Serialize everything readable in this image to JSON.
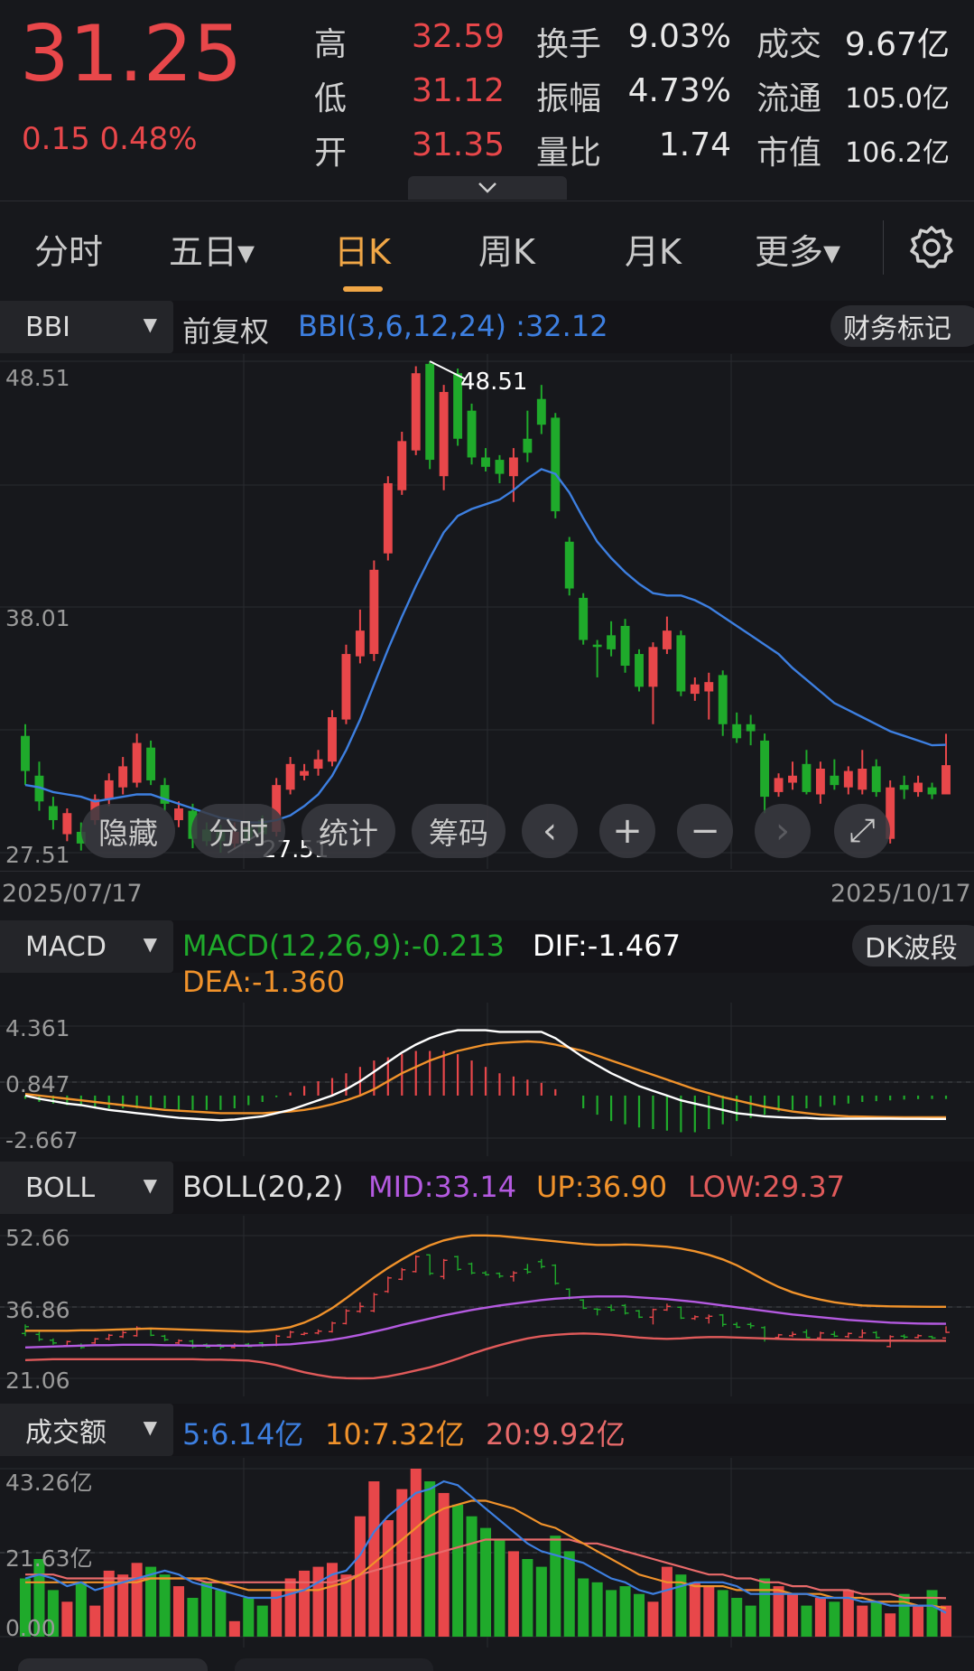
{
  "quote": {
    "price": "31.25",
    "change": "0.15",
    "change_pct": "0.48%",
    "high_label": "高",
    "high": "32.59",
    "low_label": "低",
    "low": "31.12",
    "open_label": "开",
    "open": "31.35",
    "turnover_label": "换手",
    "turnover": "9.03%",
    "amplitude_label": "振幅",
    "amplitude": "4.73%",
    "volratio_label": "量比",
    "volratio": "1.74",
    "amount_label": "成交",
    "amount": "9.67亿",
    "float_label": "流通",
    "float": "105.0亿",
    "mcap_label": "市值",
    "mcap": "106.2亿"
  },
  "tabs": [
    {
      "label": "分时"
    },
    {
      "label": "五日▾"
    },
    {
      "label": "日K"
    },
    {
      "label": "周K"
    },
    {
      "label": "月K"
    },
    {
      "label": "更多▾"
    }
  ],
  "active_tab": "日K",
  "main": {
    "indicator": "BBI",
    "adjust": "前复权",
    "formula": "BBI(3,6,12,24)",
    "value": ":32.12",
    "button": "财务标记",
    "y_top": "48.51",
    "y_mid": "38.01",
    "y_bot": "27.51",
    "max_label": "48.51",
    "min_label": "27.51",
    "date_start": "2025/07/17",
    "date_end": "2025/10/17"
  },
  "controls": {
    "hide": "隐藏",
    "intraday": "分时",
    "stats": "统计",
    "chips": "筹码",
    "prev": "‹",
    "zoom_in": "+",
    "zoom_out": "−",
    "next": "›",
    "expand": "⤢"
  },
  "macd": {
    "indicator": "MACD",
    "formula": "MACD(12,26,9):-0.213",
    "dif": "DIF:-1.467",
    "dea": "DEA:-1.360",
    "button": "DK波段",
    "y_top": "4.361",
    "y_mid": "0.847",
    "y_bot": "-2.667"
  },
  "boll": {
    "indicator": "BOLL",
    "formula": "BOLL(20,2)",
    "mid": "MID:33.14",
    "up": "UP:36.90",
    "low": "LOW:29.37",
    "y_top": "52.66",
    "y_mid": "36.86",
    "y_bot": "21.06"
  },
  "volume": {
    "indicator": "成交额",
    "ma5": "5:6.14亿",
    "ma10": "10:7.32亿",
    "ma20": "20:9.92亿",
    "y_top": "43.26亿",
    "y_mid": "21.63亿",
    "y_bot": "0.00"
  },
  "colors": {
    "up": "#e8474a",
    "down": "#1faa2b",
    "bbi": "#3d7fe0",
    "dif": "#ffffff",
    "dea": "#f0922b",
    "boll_mid": "#b45ae0",
    "boll_up": "#f0922b",
    "boll_low": "#e05a5a",
    "ma5": "#3d7fe0",
    "ma10": "#f0922b",
    "ma20": "#e86a6a"
  },
  "chart_data": {
    "type": "candlestick",
    "candles": [
      [
        1,
        31.0,
        32.5,
        33.0,
        30.4
      ],
      [
        1,
        30.8,
        29.7,
        31.4,
        29.3
      ],
      [
        1,
        29.5,
        28.9,
        29.9,
        28.5
      ],
      [
        0,
        28.3,
        29.2,
        29.4,
        28.0
      ],
      [
        1,
        28.4,
        27.9,
        28.8,
        27.6
      ],
      [
        0,
        28.9,
        29.8,
        30.0,
        28.7
      ],
      [
        0,
        29.8,
        30.6,
        30.9,
        29.5
      ],
      [
        0,
        30.3,
        31.2,
        31.6,
        30.0
      ],
      [
        0,
        30.5,
        32.2,
        32.6,
        30.3
      ],
      [
        1,
        32.0,
        30.6,
        32.3,
        30.4
      ],
      [
        1,
        30.4,
        29.6,
        30.7,
        29.3
      ],
      [
        0,
        28.9,
        29.4,
        29.7,
        28.6
      ],
      [
        1,
        29.3,
        28.1,
        29.6,
        27.7
      ],
      [
        1,
        28.5,
        28.0,
        28.8,
        27.8
      ],
      [
        1,
        28.5,
        28.0,
        28.7,
        27.51
      ],
      [
        0,
        27.9,
        28.4,
        28.8,
        27.7
      ],
      [
        1,
        28.6,
        28.1,
        28.9,
        27.9
      ],
      [
        1,
        28.9,
        28.3,
        29.1,
        28.0
      ],
      [
        0,
        28.4,
        30.4,
        30.7,
        28.2
      ],
      [
        0,
        30.2,
        31.3,
        31.6,
        30.0
      ],
      [
        0,
        30.8,
        31.0,
        31.3,
        30.6
      ],
      [
        0,
        31.1,
        31.5,
        31.9,
        30.8
      ],
      [
        0,
        31.4,
        33.3,
        33.6,
        31.2
      ],
      [
        0,
        33.2,
        36.0,
        36.4,
        33.0
      ],
      [
        0,
        35.9,
        37.0,
        37.9,
        35.6
      ],
      [
        0,
        36.0,
        39.6,
        40.0,
        35.7
      ],
      [
        0,
        40.3,
        43.3,
        43.6,
        40.0
      ],
      [
        0,
        43.0,
        45.1,
        45.5,
        42.8
      ],
      [
        0,
        44.7,
        48.0,
        48.3,
        44.5
      ],
      [
        1,
        48.4,
        44.3,
        48.51,
        43.9
      ],
      [
        0,
        43.6,
        47.2,
        47.5,
        43.0
      ],
      [
        1,
        48.0,
        45.2,
        48.2,
        44.9
      ],
      [
        1,
        46.4,
        44.4,
        46.7,
        44.1
      ],
      [
        1,
        44.4,
        44.0,
        44.8,
        43.8
      ],
      [
        1,
        44.3,
        43.7,
        44.5,
        43.3
      ],
      [
        0,
        43.6,
        44.4,
        44.8,
        42.5
      ],
      [
        1,
        45.2,
        44.6,
        46.4,
        44.2
      ],
      [
        1,
        46.9,
        45.8,
        47.5,
        45.4
      ],
      [
        1,
        46.1,
        42.1,
        46.3,
        41.8
      ],
      [
        1,
        40.8,
        38.8,
        41.0,
        38.5
      ],
      [
        1,
        38.4,
        36.6,
        38.6,
        36.4
      ],
      [
        1,
        36.4,
        36.3,
        36.6,
        35.0
      ],
      [
        1,
        36.8,
        36.2,
        37.4,
        35.9
      ],
      [
        1,
        37.2,
        35.5,
        37.5,
        35.2
      ],
      [
        1,
        36.0,
        34.6,
        36.2,
        34.4
      ],
      [
        0,
        34.6,
        36.3,
        36.5,
        33.0
      ],
      [
        0,
        36.2,
        37.0,
        37.6,
        36.0
      ],
      [
        1,
        36.8,
        34.4,
        37.0,
        34.2
      ],
      [
        0,
        34.3,
        34.7,
        35.0,
        34.0
      ],
      [
        0,
        34.4,
        34.8,
        35.2,
        33.2
      ],
      [
        1,
        35.1,
        33.0,
        35.3,
        32.5
      ],
      [
        1,
        33.0,
        32.4,
        33.5,
        32.2
      ],
      [
        1,
        33.0,
        32.7,
        33.4,
        32.1
      ],
      [
        1,
        32.3,
        29.9,
        32.6,
        29.2
      ],
      [
        0,
        30.1,
        30.7,
        30.9,
        29.9
      ],
      [
        0,
        30.5,
        30.8,
        31.4,
        30.2
      ],
      [
        1,
        31.3,
        30.1,
        31.9,
        30.0
      ],
      [
        0,
        30.0,
        31.1,
        31.4,
        29.6
      ],
      [
        1,
        30.8,
        30.4,
        31.5,
        30.2
      ],
      [
        0,
        30.3,
        31.0,
        31.2,
        30.0
      ],
      [
        0,
        30.2,
        31.1,
        31.9,
        30.0
      ],
      [
        1,
        31.2,
        30.1,
        31.5,
        29.9
      ],
      [
        0,
        28.1,
        30.3,
        30.6,
        27.9
      ],
      [
        1,
        30.4,
        30.2,
        30.8,
        29.8
      ],
      [
        0,
        30.1,
        30.5,
        30.8,
        29.9
      ],
      [
        1,
        30.3,
        30.0,
        30.5,
        29.8
      ],
      [
        0,
        30.0,
        31.25,
        32.59,
        31.12
      ]
    ],
    "bbi": [
      30.4,
      30.3,
      30.1,
      30.0,
      29.9,
      29.7,
      29.8,
      29.9,
      30.0,
      30.0,
      29.8,
      29.6,
      29.4,
      29.2,
      29.0,
      28.9,
      28.8,
      28.8,
      28.9,
      29.1,
      29.5,
      30.0,
      30.8,
      31.9,
      33.2,
      34.7,
      36.2,
      37.6,
      38.9,
      40.1,
      41.2,
      41.9,
      42.2,
      42.4,
      42.6,
      43.0,
      43.5,
      43.9,
      43.7,
      42.9,
      41.8,
      40.8,
      40.1,
      39.5,
      39.0,
      38.6,
      38.5,
      38.5,
      38.3,
      38.0,
      37.6,
      37.2,
      36.8,
      36.4,
      36.0,
      35.4,
      34.9,
      34.4,
      33.9,
      33.6,
      33.3,
      33.0,
      32.7,
      32.5,
      32.3,
      32.1,
      32.12
    ],
    "macd": {
      "dif": [
        0.0,
        -0.2,
        -0.35,
        -0.5,
        -0.6,
        -0.75,
        -0.9,
        -1.0,
        -1.1,
        -1.2,
        -1.3,
        -1.4,
        -1.45,
        -1.5,
        -1.55,
        -1.5,
        -1.4,
        -1.3,
        -1.1,
        -0.9,
        -0.6,
        -0.3,
        0.0,
        0.4,
        0.9,
        1.5,
        2.1,
        2.7,
        3.2,
        3.6,
        3.9,
        4.1,
        4.1,
        4.1,
        4.0,
        4.0,
        4.0,
        4.0,
        3.6,
        3.0,
        2.4,
        1.9,
        1.4,
        1.0,
        0.6,
        0.3,
        0.0,
        -0.3,
        -0.5,
        -0.7,
        -0.9,
        -1.1,
        -1.2,
        -1.3,
        -1.35,
        -1.4,
        -1.4,
        -1.45,
        -1.45,
        -1.45,
        -1.45,
        -1.45,
        -1.45,
        -1.46,
        -1.46,
        -1.467,
        -1.467
      ],
      "dea": [
        0.1,
        0.0,
        -0.1,
        -0.2,
        -0.3,
        -0.4,
        -0.5,
        -0.6,
        -0.7,
        -0.8,
        -0.9,
        -0.95,
        -1.0,
        -1.05,
        -1.1,
        -1.1,
        -1.1,
        -1.1,
        -1.05,
        -1.0,
        -0.9,
        -0.75,
        -0.55,
        -0.3,
        0.0,
        0.4,
        0.9,
        1.4,
        1.8,
        2.2,
        2.5,
        2.8,
        3.0,
        3.2,
        3.3,
        3.35,
        3.4,
        3.35,
        3.2,
        3.0,
        2.8,
        2.5,
        2.2,
        1.9,
        1.6,
        1.3,
        1.0,
        0.7,
        0.4,
        0.15,
        -0.1,
        -0.3,
        -0.5,
        -0.7,
        -0.85,
        -1.0,
        -1.1,
        -1.2,
        -1.25,
        -1.3,
        -1.32,
        -1.34,
        -1.35,
        -1.36,
        -1.36,
        -1.36,
        -1.36
      ],
      "hist": [
        -0.2,
        -0.4,
        -0.5,
        -0.6,
        -0.6,
        -0.7,
        -0.8,
        -0.8,
        -0.8,
        -0.8,
        -0.8,
        -0.9,
        -0.9,
        -0.9,
        -0.9,
        -0.8,
        -0.6,
        -0.4,
        -0.1,
        0.2,
        0.6,
        0.9,
        1.1,
        1.4,
        1.8,
        2.2,
        2.4,
        2.6,
        2.8,
        2.8,
        2.8,
        2.6,
        2.2,
        1.8,
        1.4,
        1.2,
        1.0,
        0.8,
        0.4,
        0.0,
        -0.8,
        -1.2,
        -1.6,
        -1.8,
        -2.0,
        -2.1,
        -2.2,
        -2.3,
        -2.3,
        -2.1,
        -1.8,
        -1.6,
        -1.4,
        -1.2,
        -1.0,
        -0.9,
        -0.8,
        -0.7,
        -0.6,
        -0.5,
        -0.4,
        -0.35,
        -0.3,
        -0.25,
        -0.22,
        -0.213,
        -0.213
      ]
    },
    "boll": {
      "mid": [
        27.9,
        28.0,
        28.1,
        28.2,
        28.3,
        28.4,
        28.4,
        28.5,
        28.5,
        28.5,
        28.4,
        28.4,
        28.3,
        28.3,
        28.3,
        28.3,
        28.3,
        28.4,
        28.5,
        28.6,
        28.9,
        29.2,
        29.6,
        30.1,
        30.7,
        31.4,
        32.1,
        32.9,
        33.6,
        34.3,
        35.0,
        35.6,
        36.2,
        36.7,
        37.2,
        37.6,
        38.0,
        38.4,
        38.7,
        38.9,
        39.1,
        39.2,
        39.2,
        39.2,
        39.0,
        38.8,
        38.6,
        38.3,
        38.0,
        37.6,
        37.2,
        36.8,
        36.4,
        36.0,
        35.6,
        35.2,
        34.9,
        34.6,
        34.3,
        34.0,
        33.8,
        33.6,
        33.4,
        33.3,
        33.2,
        33.15,
        33.14
      ],
      "up": [
        31.6,
        31.6,
        31.6,
        31.6,
        31.7,
        31.7,
        31.8,
        31.9,
        32.0,
        32.1,
        32.0,
        31.9,
        31.8,
        31.7,
        31.6,
        31.5,
        31.4,
        31.6,
        31.9,
        32.4,
        33.4,
        34.8,
        36.6,
        38.8,
        41.1,
        43.4,
        45.5,
        47.4,
        49.1,
        50.5,
        51.6,
        52.3,
        52.7,
        52.7,
        52.6,
        52.3,
        52.0,
        51.7,
        51.4,
        51.1,
        50.8,
        50.6,
        50.6,
        50.7,
        50.6,
        50.4,
        50.2,
        49.8,
        49.2,
        48.4,
        47.4,
        46.1,
        44.5,
        42.8,
        41.3,
        40.1,
        39.2,
        38.5,
        37.9,
        37.5,
        37.2,
        37.1,
        37.0,
        36.95,
        36.92,
        36.9,
        36.9
      ],
      "low": [
        25.1,
        25.2,
        25.3,
        25.3,
        25.3,
        25.3,
        25.3,
        25.3,
        25.3,
        25.3,
        25.3,
        25.3,
        25.3,
        25.2,
        25.2,
        25.1,
        25.0,
        24.6,
        24.0,
        23.2,
        22.4,
        21.8,
        21.3,
        21.1,
        21.06,
        21.1,
        21.5,
        22.1,
        22.8,
        23.5,
        24.4,
        25.4,
        26.5,
        27.5,
        28.4,
        29.2,
        29.9,
        30.4,
        30.7,
        30.9,
        31.0,
        30.9,
        30.7,
        30.4,
        30.1,
        29.9,
        29.8,
        29.9,
        30.1,
        30.2,
        30.2,
        30.1,
        30.0,
        29.9,
        29.8,
        29.7,
        29.65,
        29.6,
        29.55,
        29.5,
        29.45,
        29.4,
        29.4,
        29.4,
        29.38,
        29.37,
        29.37
      ]
    },
    "volume": {
      "amounts": [
        15,
        20,
        12,
        9,
        14,
        8,
        17,
        16,
        19,
        18,
        16,
        13,
        10,
        14,
        12,
        4,
        10,
        8,
        12,
        15,
        17,
        18,
        19,
        16,
        31,
        40,
        30,
        38,
        43.26,
        40,
        37,
        34,
        31,
        28,
        25,
        22,
        20,
        18,
        26,
        22,
        15,
        14,
        12,
        13,
        11,
        9,
        18,
        16,
        14,
        13,
        12,
        10,
        8,
        15,
        13,
        11,
        8,
        10,
        9,
        12,
        8,
        9,
        6,
        11,
        8,
        12,
        8
      ],
      "dir": [
        1,
        1,
        1,
        0,
        1,
        0,
        0,
        0,
        0,
        1,
        1,
        0,
        1,
        1,
        1,
        0,
        1,
        1,
        0,
        0,
        0,
        0,
        0,
        0,
        0,
        0,
        0,
        0,
        0,
        1,
        0,
        1,
        1,
        1,
        1,
        0,
        1,
        1,
        1,
        1,
        1,
        1,
        1,
        1,
        1,
        0,
        0,
        1,
        0,
        0,
        1,
        1,
        1,
        1,
        0,
        0,
        1,
        0,
        1,
        0,
        0,
        1,
        0,
        1,
        0,
        1,
        0
      ],
      "ma5": [
        15,
        16,
        15,
        13,
        14,
        12,
        13,
        14,
        15,
        16,
        17,
        16,
        14,
        13,
        12,
        11,
        10,
        10,
        10,
        11,
        12,
        14,
        16,
        17,
        21,
        27,
        31,
        34,
        37,
        38,
        40,
        39,
        36,
        33,
        30,
        27,
        24,
        22,
        21,
        20,
        19,
        17,
        15,
        14,
        12,
        11,
        12,
        13,
        14,
        14,
        14,
        13,
        11,
        11,
        11,
        11,
        11,
        10,
        10,
        10,
        9,
        9,
        8,
        8,
        8,
        8,
        6.14
      ],
      "ma10": [
        14,
        14,
        14,
        14,
        14,
        14,
        14,
        14,
        14,
        15,
        15,
        15,
        15,
        15,
        14,
        13,
        12,
        12,
        12,
        12,
        12,
        12,
        13,
        14,
        16,
        19,
        22,
        25,
        28,
        31,
        33,
        34,
        35,
        35,
        34,
        33,
        31,
        29,
        28,
        26,
        24,
        22,
        20,
        18,
        16,
        15,
        14,
        14,
        13,
        13,
        13,
        12,
        12,
        12,
        12,
        11,
        11,
        11,
        10,
        10,
        10,
        9,
        9,
        9,
        8,
        8,
        7.32
      ],
      "ma20": [
        16,
        16,
        16,
        15,
        15,
        15,
        15,
        15,
        15,
        15,
        15,
        15,
        15,
        14,
        14,
        14,
        14,
        14,
        14,
        14,
        14,
        14,
        14,
        15,
        16,
        17,
        18,
        19,
        20,
        21,
        22,
        23,
        24,
        25,
        25,
        25,
        25,
        25,
        25,
        25,
        24,
        24,
        23,
        22,
        21,
        20,
        19,
        18,
        17,
        16,
        16,
        15,
        15,
        14,
        14,
        13,
        13,
        12,
        12,
        12,
        11,
        11,
        11,
        10,
        10,
        10,
        9.92
      ]
    }
  }
}
